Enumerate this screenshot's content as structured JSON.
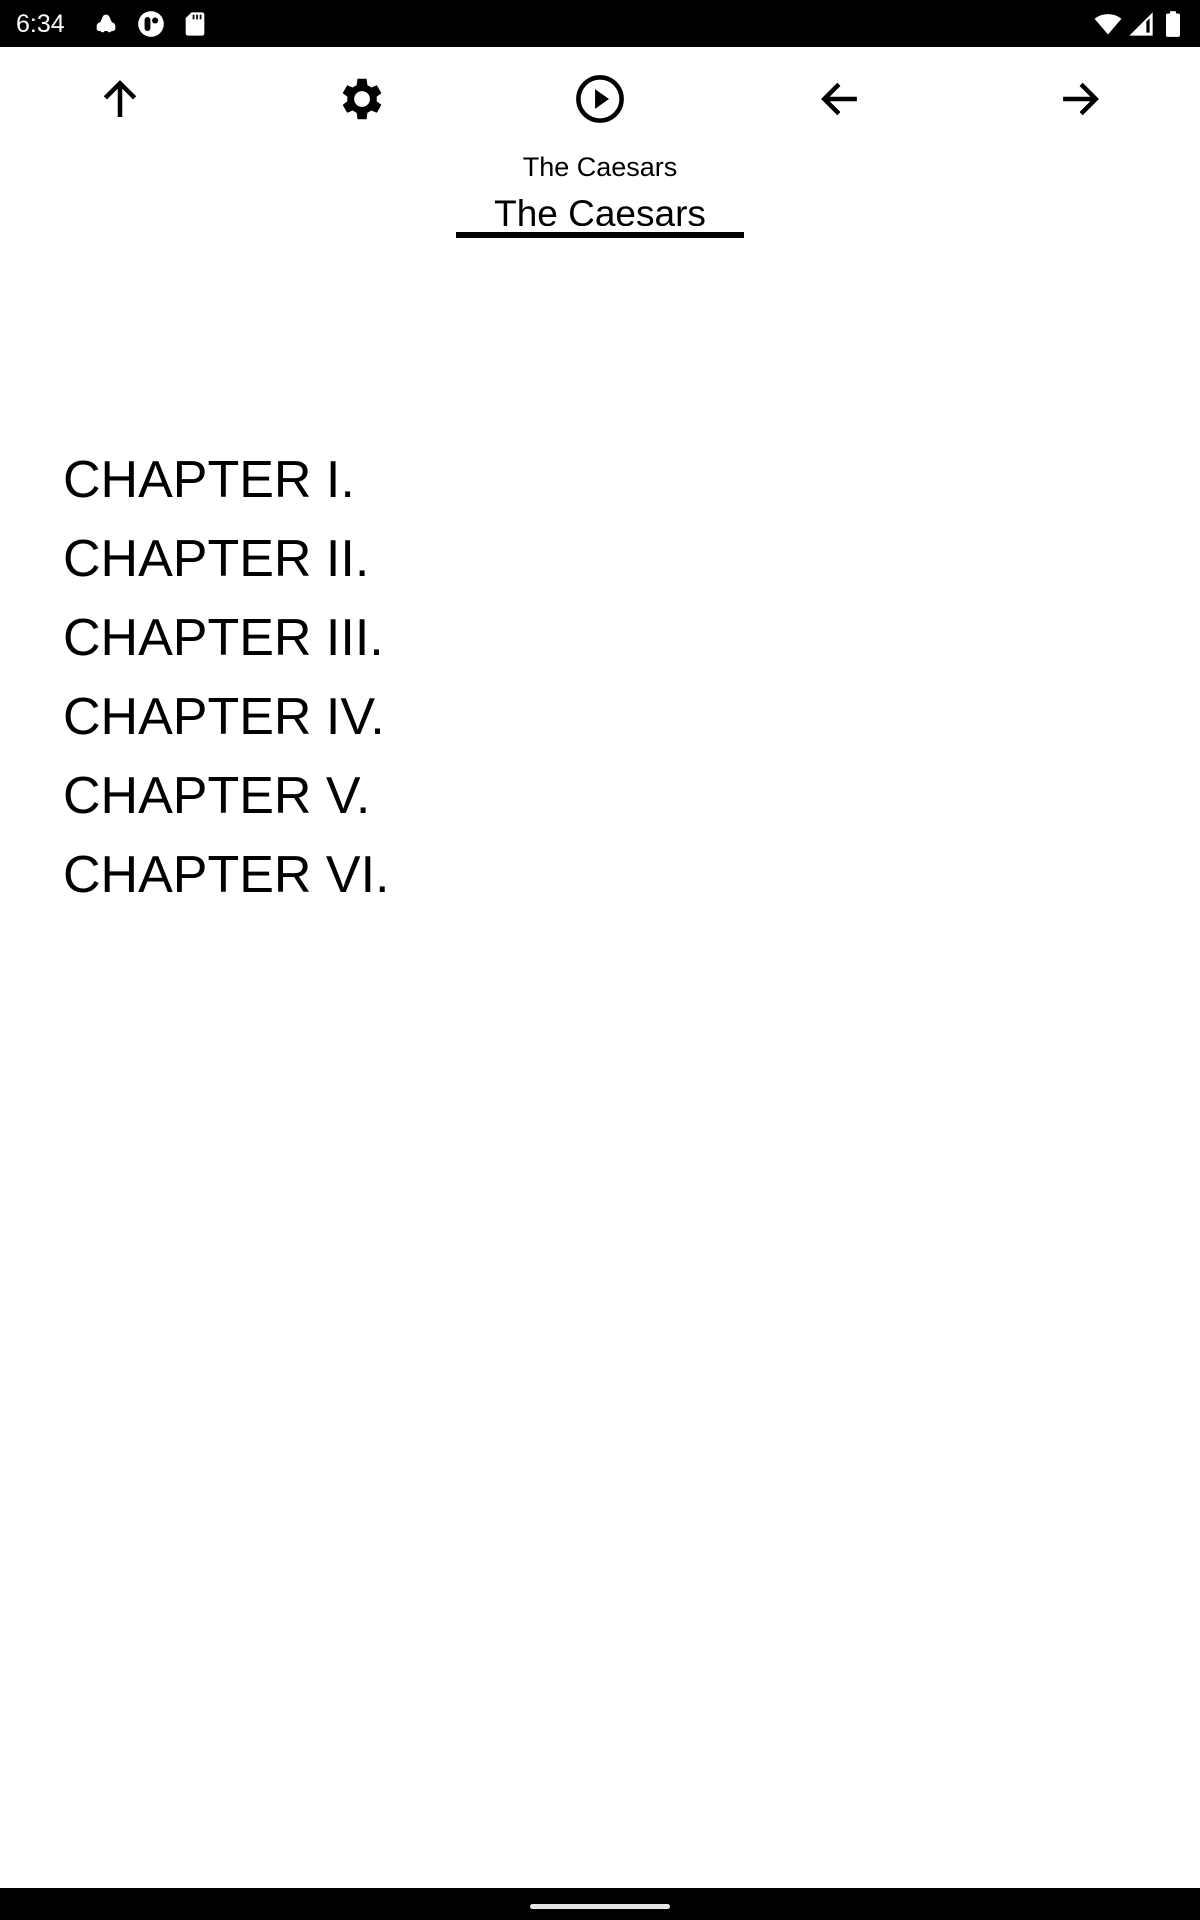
{
  "status_bar": {
    "time": "6:34",
    "left_icons": [
      "car-icon",
      "app-notification-icon",
      "sd-card-icon"
    ],
    "right_icons": [
      "wifi-icon",
      "cell-signal-icon",
      "battery-icon"
    ]
  },
  "toolbar": {
    "buttons": [
      {
        "name": "up",
        "icon": "arrow-up-icon"
      },
      {
        "name": "settings",
        "icon": "gear-icon"
      },
      {
        "name": "play",
        "icon": "play-circle-icon"
      },
      {
        "name": "previous",
        "icon": "arrow-left-icon"
      },
      {
        "name": "next",
        "icon": "arrow-right-icon"
      }
    ]
  },
  "book": {
    "subtitle": "The Caesars",
    "tab_title": "The Caesars"
  },
  "chapters": [
    {
      "label": "CHAPTER I."
    },
    {
      "label": "CHAPTER II."
    },
    {
      "label": "CHAPTER III."
    },
    {
      "label": "CHAPTER IV."
    },
    {
      "label": "CHAPTER V."
    },
    {
      "label": "CHAPTER VI."
    }
  ],
  "colors": {
    "status_bar_bg": "#000000",
    "page_bg": "#ffffff",
    "text": "#000000",
    "home_indicator": "#e6e6e6"
  }
}
